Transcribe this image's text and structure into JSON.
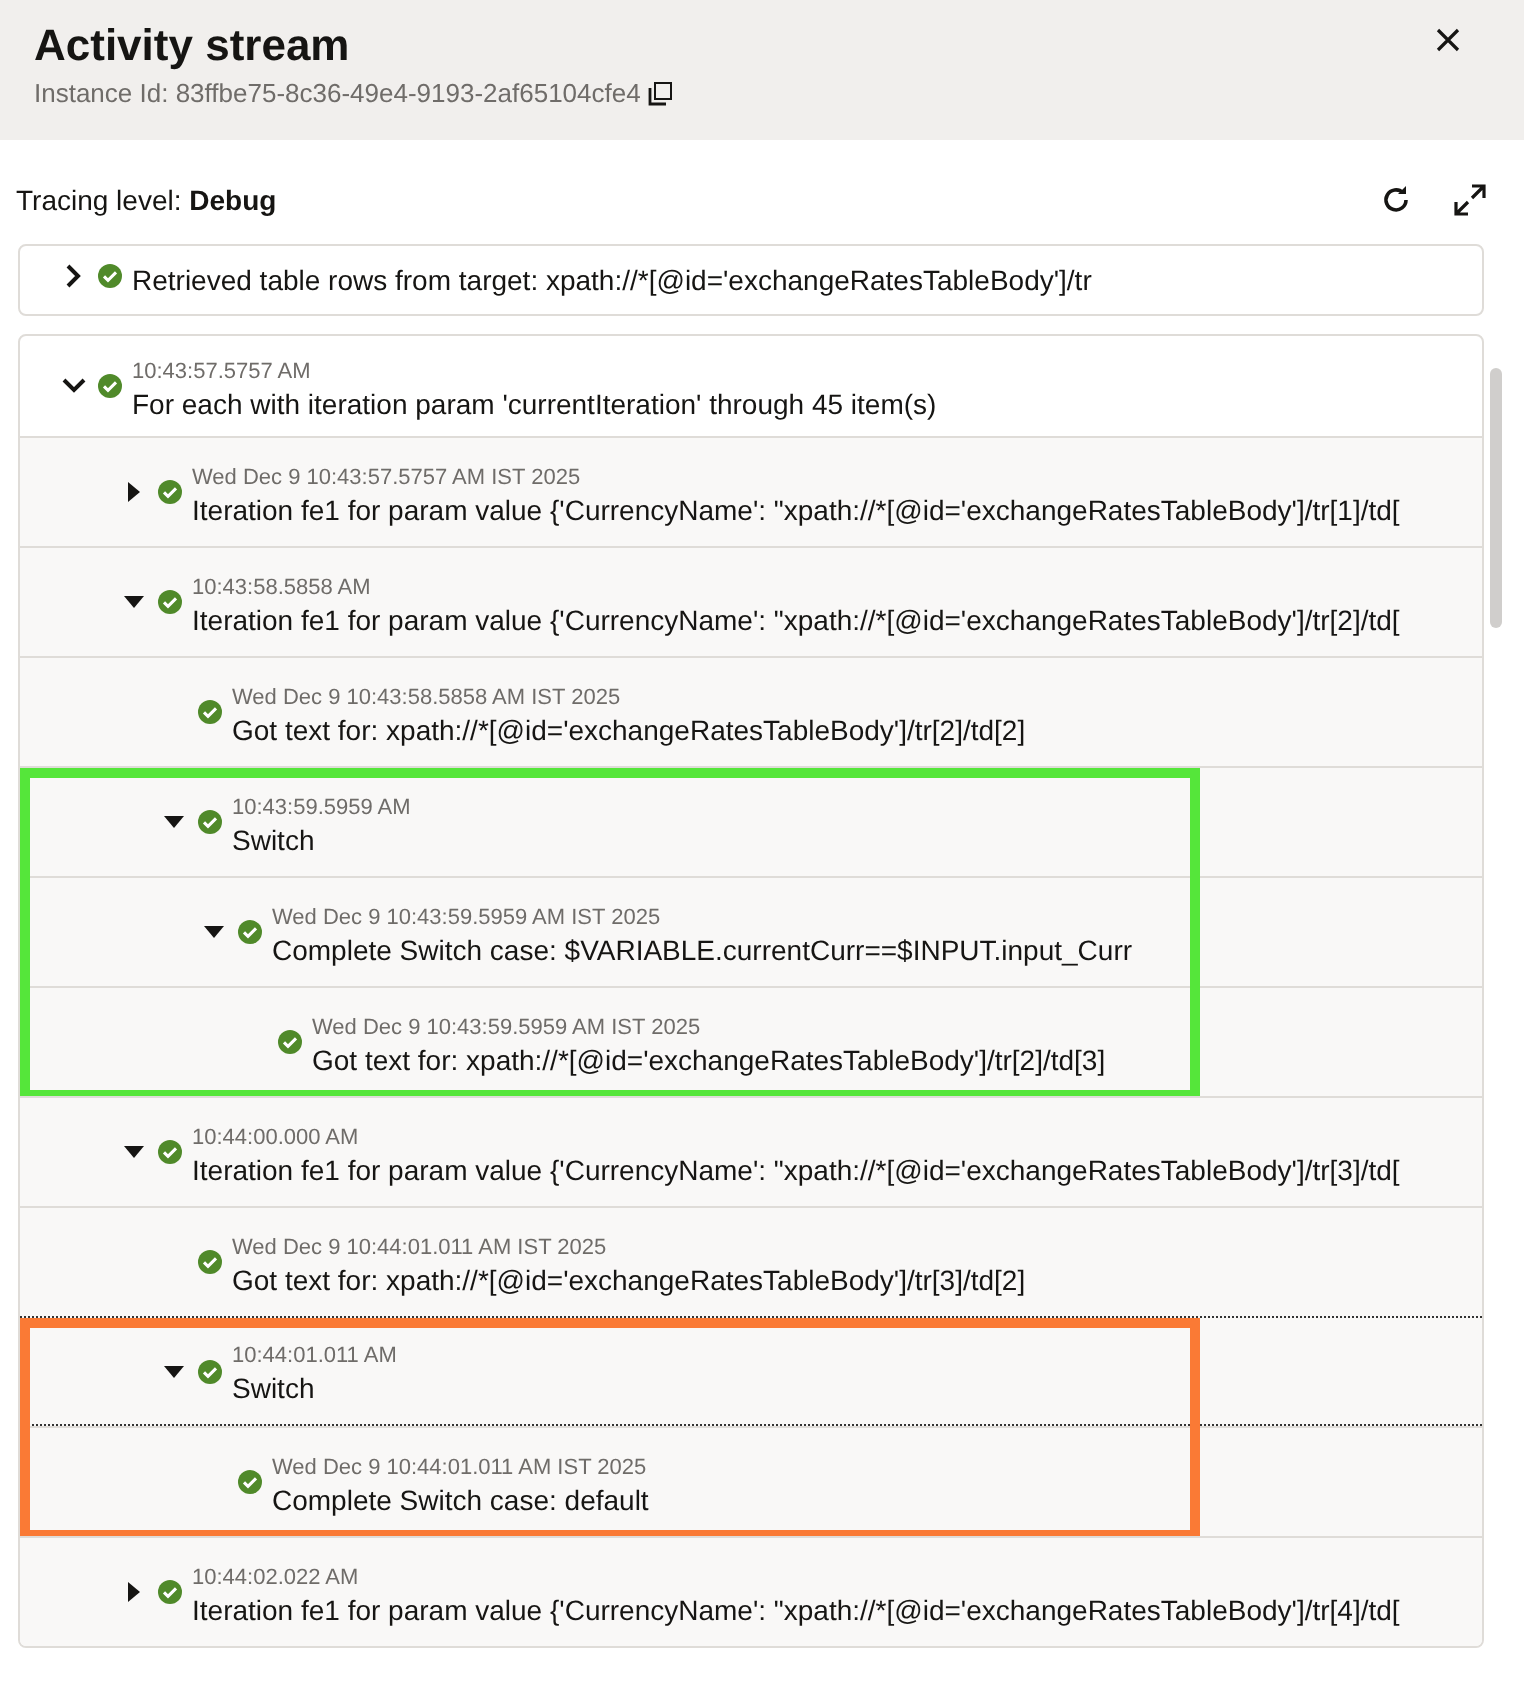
{
  "header": {
    "title": "Activity stream",
    "instance_id": "Instance Id: 83ffbe75-8c36-49e4-9193-2af65104cfe4"
  },
  "tracing": {
    "label": "Tracing level: ",
    "value": "Debug"
  },
  "entries": [
    {
      "message": "Retrieved table rows from target: xpath://*[@id='exchangeRatesTableBody']/tr",
      "expanded": false
    },
    {
      "time": "10:43:57.5757 AM",
      "message": "For each with iteration param 'currentIteration' through 45 item(s)",
      "expanded": true,
      "children": [
        {
          "time": "Wed Dec 9 10:43:57.5757 AM IST 2025",
          "message": "Iteration fe1 for param value {'CurrencyName': \"xpath://*[@id='exchangeRatesTableBody']/tr[1]/td[",
          "expanded": false
        },
        {
          "time": "10:43:58.5858 AM",
          "message": "Iteration fe1 for param value {'CurrencyName': \"xpath://*[@id='exchangeRatesTableBody']/tr[2]/td[",
          "expanded": true,
          "children": [
            {
              "time": "Wed Dec 9 10:43:58.5858 AM IST 2025",
              "message": "Got text for: xpath://*[@id='exchangeRatesTableBody']/tr[2]/td[2]"
            },
            {
              "time": "10:43:59.5959 AM",
              "message": "Switch",
              "expanded": true,
              "color": "#55e63a",
              "children": [
                {
                  "time": "Wed Dec 9 10:43:59.5959 AM IST 2025",
                  "message": "Complete Switch case: $VARIABLE.currentCurr==$INPUT.input_Curr",
                  "expanded": true,
                  "children": [
                    {
                      "time": "Wed Dec 9 10:43:59.5959 AM IST 2025",
                      "message": "Got text for: xpath://*[@id='exchangeRatesTableBody']/tr[2]/td[3]"
                    }
                  ]
                }
              ]
            }
          ]
        },
        {
          "time": "10:44:00.000 AM",
          "message": "Iteration fe1 for param value {'CurrencyName': \"xpath://*[@id='exchangeRatesTableBody']/tr[3]/td[",
          "expanded": true,
          "children": [
            {
              "time": "Wed Dec 9 10:44:01.011 AM IST 2025",
              "message": "Got text for: xpath://*[@id='exchangeRatesTableBody']/tr[3]/td[2]"
            },
            {
              "time": "10:44:01.011 AM",
              "message": "Switch",
              "expanded": true,
              "focused": true,
              "color": "#fa7a35",
              "children": [
                {
                  "time": "Wed Dec 9 10:44:01.011 AM IST 2025",
                  "message": "Complete Switch case: default"
                }
              ]
            }
          ]
        },
        {
          "time": "10:44:02.022 AM",
          "message": "Iteration fe1 for param value {'CurrencyName': \"xpath://*[@id='exchangeRatesTableBody']/tr[4]/td[",
          "expanded": false
        }
      ]
    }
  ]
}
